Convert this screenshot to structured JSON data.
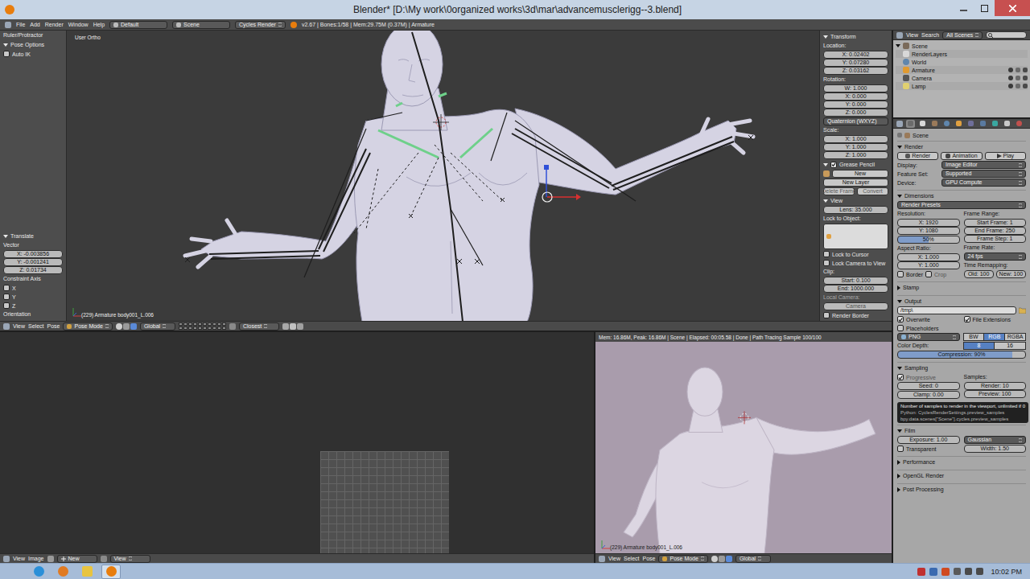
{
  "window": {
    "title": "Blender* [D:\\My work\\0organized works\\3d\\mar\\advancemusclerigg--3.blend]"
  },
  "info_header": {
    "menus": [
      "File",
      "Add",
      "Render",
      "Window",
      "Help"
    ],
    "layout": "Default",
    "scene": "Scene",
    "engine": "Cycles Render",
    "stats": "v2.67 | Bones:1/58 | Mem:29.75M (0.37M) | Armature"
  },
  "toolshelf": {
    "cut_label": "Ruler/Protractor",
    "pose_options": {
      "title": "Pose Options",
      "expanded": true,
      "items": [
        {
          "label": "Auto IK",
          "checked": false
        }
      ]
    },
    "operator": {
      "title": "Translate",
      "expanded": true,
      "vector_label": "Vector",
      "vector": [
        "X: -0.003856",
        "Y: -0.001241",
        "Z: 0.01734"
      ],
      "constraint_label": "Constraint Axis",
      "constraints": [
        {
          "label": "X",
          "checked": false
        },
        {
          "label": "Y",
          "checked": false
        },
        {
          "label": "Z",
          "checked": false
        }
      ],
      "orientation_label": "Orientation"
    }
  },
  "viewport": {
    "view_name": "User Ortho",
    "active_object": "(229) Armature body001_L.006",
    "header": {
      "menus": [
        "View",
        "Select",
        "Pose"
      ],
      "mode": "Pose Mode",
      "orientation": "Global",
      "snap": "Closest"
    }
  },
  "n_panel": {
    "transform": {
      "title": "Transform",
      "expanded": true,
      "location_label": "Location:",
      "location": [
        "X: 0.02402",
        "Y: 0.07280",
        "Z: 0.03162"
      ],
      "rotation_label": "Rotation:",
      "rotation": [
        "W: 1.000",
        "X: 0.000",
        "Y: 0.000",
        "Z: 0.000"
      ],
      "rotation_mode": "Quaternion (WXYZ)",
      "scale_label": "Scale:",
      "scale": [
        "X: 1.000",
        "Y: 1.000",
        "Z: 1.000"
      ]
    },
    "grease_pencil": {
      "title": "Grease Pencil",
      "expanded": true,
      "checked": true,
      "new": "New",
      "new_layer": "New Layer",
      "frame_buttons": [
        {
          "label": "Delete Frame",
          "disabled": true
        },
        {
          "label": "Convert",
          "disabled": true
        }
      ]
    },
    "view": {
      "title": "View",
      "expanded": true,
      "lens": "Lens: 35.000",
      "lock_object_label": "Lock to Object:",
      "locks": [
        {
          "label": "Lock to Cursor",
          "checked": false
        },
        {
          "label": "Lock Camera to View",
          "checked": false
        }
      ],
      "clip_label": "Clip:",
      "clip": [
        "Start: 0.100",
        "End: 1000.000"
      ],
      "local_camera_label": "Local Camera:",
      "local_camera": "Camera",
      "local_camera_disabled": true,
      "render_border": {
        "label": "Render Border",
        "checked": false
      }
    }
  },
  "outliner": {
    "header": {
      "menus": [
        "View",
        "Search"
      ],
      "filter": "All Scenes"
    },
    "items": [
      {
        "name": "Scene",
        "depth": 0,
        "kind": "scene",
        "expanded": true
      },
      {
        "name": "RenderLayers",
        "depth": 1,
        "kind": "renderlayers",
        "expanded": false
      },
      {
        "name": "World",
        "depth": 1,
        "kind": "world",
        "expanded": false
      },
      {
        "name": "Armature",
        "depth": 1,
        "kind": "armature",
        "expanded": false
      },
      {
        "name": "Camera",
        "depth": 1,
        "kind": "camera",
        "expanded": false
      },
      {
        "name": "Lamp",
        "depth": 1,
        "kind": "lamp",
        "expanded": false
      }
    ]
  },
  "properties": {
    "tabs": [
      {
        "kind": "render",
        "selected": true
      },
      {
        "kind": "layers",
        "selected": false
      },
      {
        "kind": "scene",
        "selected": false
      },
      {
        "kind": "world",
        "selected": false
      },
      {
        "kind": "object",
        "selected": false
      },
      {
        "kind": "constraints",
        "selected": false
      },
      {
        "kind": "modifiers",
        "selected": false
      },
      {
        "kind": "data",
        "selected": false
      },
      {
        "kind": "bone",
        "selected": false
      },
      {
        "kind": "material",
        "selected": false
      }
    ],
    "breadcrumb": "Scene",
    "render": {
      "title": "Render",
      "expanded": true,
      "buttons": [
        "Render",
        "Animation",
        "Play"
      ],
      "rows": [
        {
          "label": "Display:",
          "value": "Image Editor"
        },
        {
          "label": "Feature Set:",
          "value": "Supported"
        },
        {
          "label": "Device:",
          "value": "GPU Compute"
        }
      ]
    },
    "dimensions": {
      "title": "Dimensions",
      "expanded": true,
      "presets": "Render Presets",
      "resolution_label": "Resolution:",
      "resolution": [
        "X: 1920",
        "Y: 1080"
      ],
      "percentage": "50%",
      "percentage_level": 0.5,
      "aspect_label": "Aspect Ratio:",
      "aspect": [
        "X: 1.000",
        "Y: 1.000"
      ],
      "border": {
        "label": "Border",
        "checked": false
      },
      "crop": {
        "label": "Crop",
        "checked": false,
        "disabled": true
      },
      "frame_range_label": "Frame Range:",
      "frame_range": [
        "Start Frame: 1",
        "End Frame: 250",
        "Frame Step: 1"
      ],
      "frame_rate_label": "Frame Rate:",
      "frame_rate": "24 fps",
      "remap_label": "Time Remapping:",
      "remap": [
        "Old: 100",
        "New: 100"
      ]
    },
    "stamp": {
      "title": "Stamp",
      "expanded": false
    },
    "output": {
      "title": "Output",
      "expanded": true,
      "path": "/tmp\\",
      "checks": [
        {
          "label": "Overwrite",
          "checked": true
        },
        {
          "label": "File Extensions",
          "checked": true
        }
      ],
      "placeholders": {
        "label": "Placeholders",
        "checked": false
      },
      "format": "PNG",
      "color_modes": [
        {
          "label": "BW",
          "selected": false
        },
        {
          "label": "RGB",
          "selected": true
        },
        {
          "label": "RGBA",
          "selected": false
        }
      ],
      "depth_label": "Color Depth:",
      "depths": [
        {
          "label": "8",
          "selected": true
        },
        {
          "label": "16",
          "selected": false
        }
      ],
      "compression": "Compression: 90%",
      "compression_level": 0.9
    },
    "sampling": {
      "title": "Sampling",
      "expanded": true,
      "progressive": {
        "label": "Progressive",
        "checked": true,
        "disabled": true
      },
      "seed": "Seed: 0",
      "clamp": "Clamp: 0.00",
      "samples_label": "Samples:",
      "samples": [
        "Render: 10",
        "Preview: 100"
      ]
    },
    "tooltip": [
      "Number of samples to render in the viewport, unlimited if 0",
      "Python: CyclesRenderSettings.preview_samples",
      "bpy.data.scenes[\"Scene\"].cycles.preview_samples"
    ],
    "film": {
      "title": "Film",
      "expanded": true,
      "exposure": "Exposure: 1.00",
      "filter": "Gaussian",
      "transparent": {
        "label": "Transparent",
        "checked": false
      },
      "width": "Width: 1.50"
    },
    "collapsed_panels": [
      {
        "title": "Performance",
        "expanded": false
      },
      {
        "title": "OpenGL Render",
        "expanded": false
      },
      {
        "title": "Post Processing",
        "expanded": false
      }
    ]
  },
  "image_editor": {
    "header": {
      "menus": [
        "View",
        "Image"
      ],
      "new": "New",
      "view": "View"
    }
  },
  "render_view": {
    "status": "Mem: 16.86M, Peak: 16.86M | Scene | Elapsed: 00:05.58 | Done | Path Tracing Sample 100/100",
    "active_object": "(229) Armature body001_L.006",
    "header": {
      "menus": [
        "View",
        "Select",
        "Pose"
      ],
      "mode": "Pose Mode",
      "orientation": "Global"
    }
  },
  "taskbar": {
    "apps": [
      {
        "kind": "ie",
        "active": false
      },
      {
        "kind": "firefox",
        "active": false
      },
      {
        "kind": "explorer",
        "active": false
      },
      {
        "kind": "blender",
        "active": true
      }
    ],
    "time": "10:02 PM"
  }
}
